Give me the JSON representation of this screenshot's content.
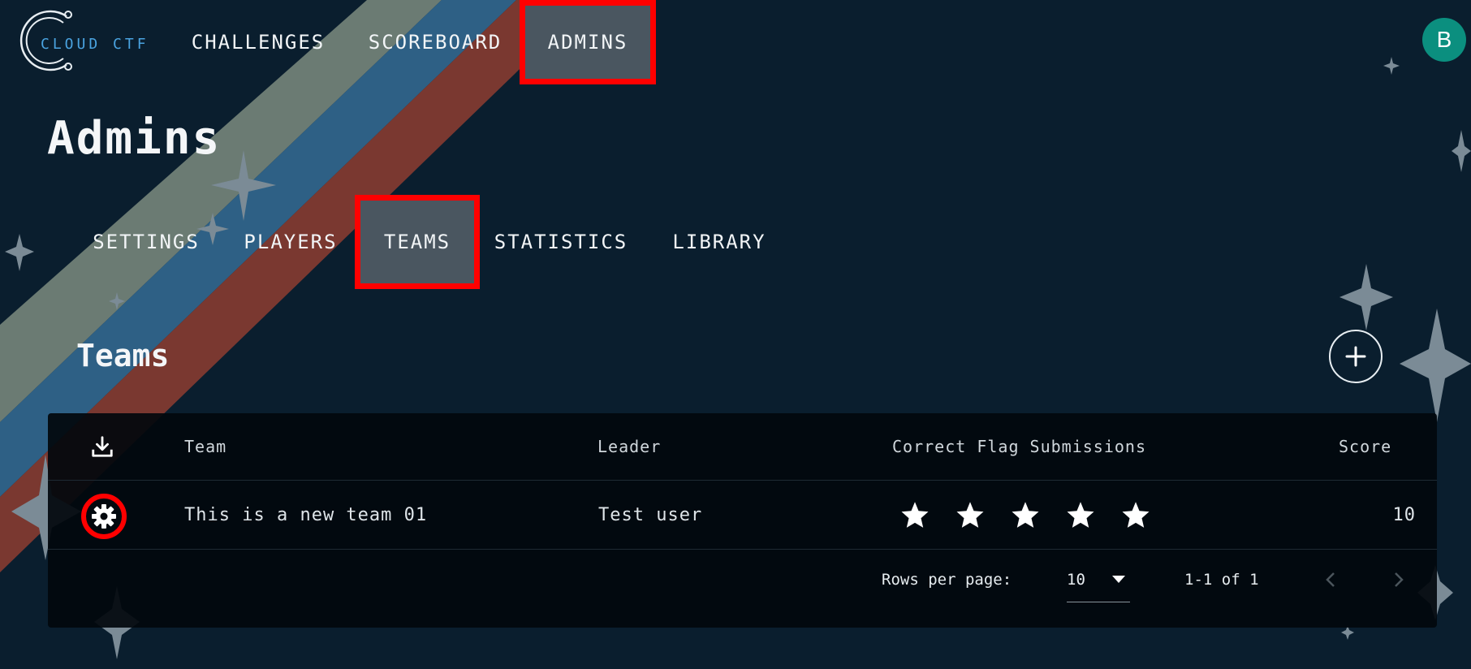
{
  "app": {
    "logo_text": "CLOUD CTF"
  },
  "nav": {
    "items": [
      {
        "label": "CHALLENGES"
      },
      {
        "label": "SCOREBOARD"
      },
      {
        "label": "ADMINS",
        "active": true
      }
    ],
    "avatar_initial": "B"
  },
  "page": {
    "title": "Admins"
  },
  "tabs": [
    {
      "label": "SETTINGS"
    },
    {
      "label": "PLAYERS"
    },
    {
      "label": "TEAMS",
      "active": true
    },
    {
      "label": "STATISTICS"
    },
    {
      "label": "LIBRARY"
    }
  ],
  "section": {
    "title": "Teams",
    "add_icon": "plus-icon"
  },
  "table": {
    "download_icon": "download-icon",
    "columns": [
      "Team",
      "Leader",
      "Correct Flag Submissions",
      "Score"
    ],
    "rows": [
      {
        "team": "This is a new team 01",
        "leader": "Test user",
        "stars": 5,
        "score": "10",
        "action_icon": "gear-icon"
      }
    ],
    "footer": {
      "rows_per_page_label": "Rows per page:",
      "rows_per_page_value": "10",
      "range_text": "1-1 of 1"
    }
  },
  "colors": {
    "background": "#0a1e2e",
    "active_highlight": "#4a5660",
    "annotation_red": "#ff0000",
    "avatar": "#0b8f7f",
    "stripe_gray": "#6b7b73",
    "stripe_blue": "#2e6085",
    "stripe_red": "#7a3830"
  }
}
